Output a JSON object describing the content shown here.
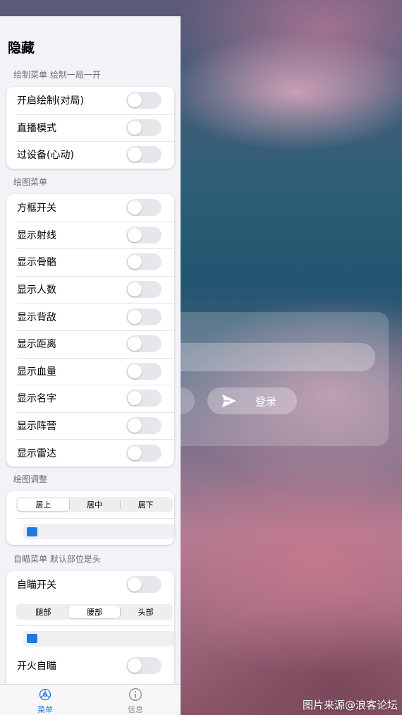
{
  "panel": {
    "title": "隐藏",
    "section_draw": "绘制菜单 绘制一局一开",
    "draw_items": [
      {
        "label": "开启绘制(对局)",
        "on": false
      },
      {
        "label": "直播模式",
        "on": false
      },
      {
        "label": "过设备(心动)",
        "on": false
      }
    ],
    "section_esp": "绘图菜单",
    "esp_items": [
      {
        "label": "方框开关",
        "on": false
      },
      {
        "label": "显示射线",
        "on": false
      },
      {
        "label": "显示骨骼",
        "on": false
      },
      {
        "label": "显示人数",
        "on": false
      },
      {
        "label": "显示背敌",
        "on": false
      },
      {
        "label": "显示距离",
        "on": false
      },
      {
        "label": "显示血量",
        "on": false
      },
      {
        "label": "显示名字",
        "on": false
      },
      {
        "label": "显示阵营",
        "on": false
      },
      {
        "label": "显示雷达",
        "on": false
      }
    ],
    "section_adjust": "绘图调整",
    "adjust_segments": [
      "居上",
      "居中",
      "居下"
    ],
    "adjust_selected": "居上",
    "adjust_color": "#1f7ae0",
    "section_aim": "自瞄菜单 默认部位是头",
    "aim_toggle": {
      "label": "自瞄开关",
      "on": false
    },
    "aim_segments": [
      "腿部",
      "腰部",
      "头部"
    ],
    "aim_selected": "腰部",
    "aim_color": "#1f7ae0",
    "fire_aim": {
      "label": "开火自瞄",
      "on": false
    }
  },
  "tabbar": {
    "tabs": [
      {
        "label": "菜单",
        "icon": "gear-icon",
        "active": true
      },
      {
        "label": "信息",
        "icon": "info-icon",
        "active": false
      }
    ],
    "accent": "#1f7ae0"
  },
  "background": {
    "login_button": "登录"
  },
  "watermark": "图片来源@浪客论坛"
}
